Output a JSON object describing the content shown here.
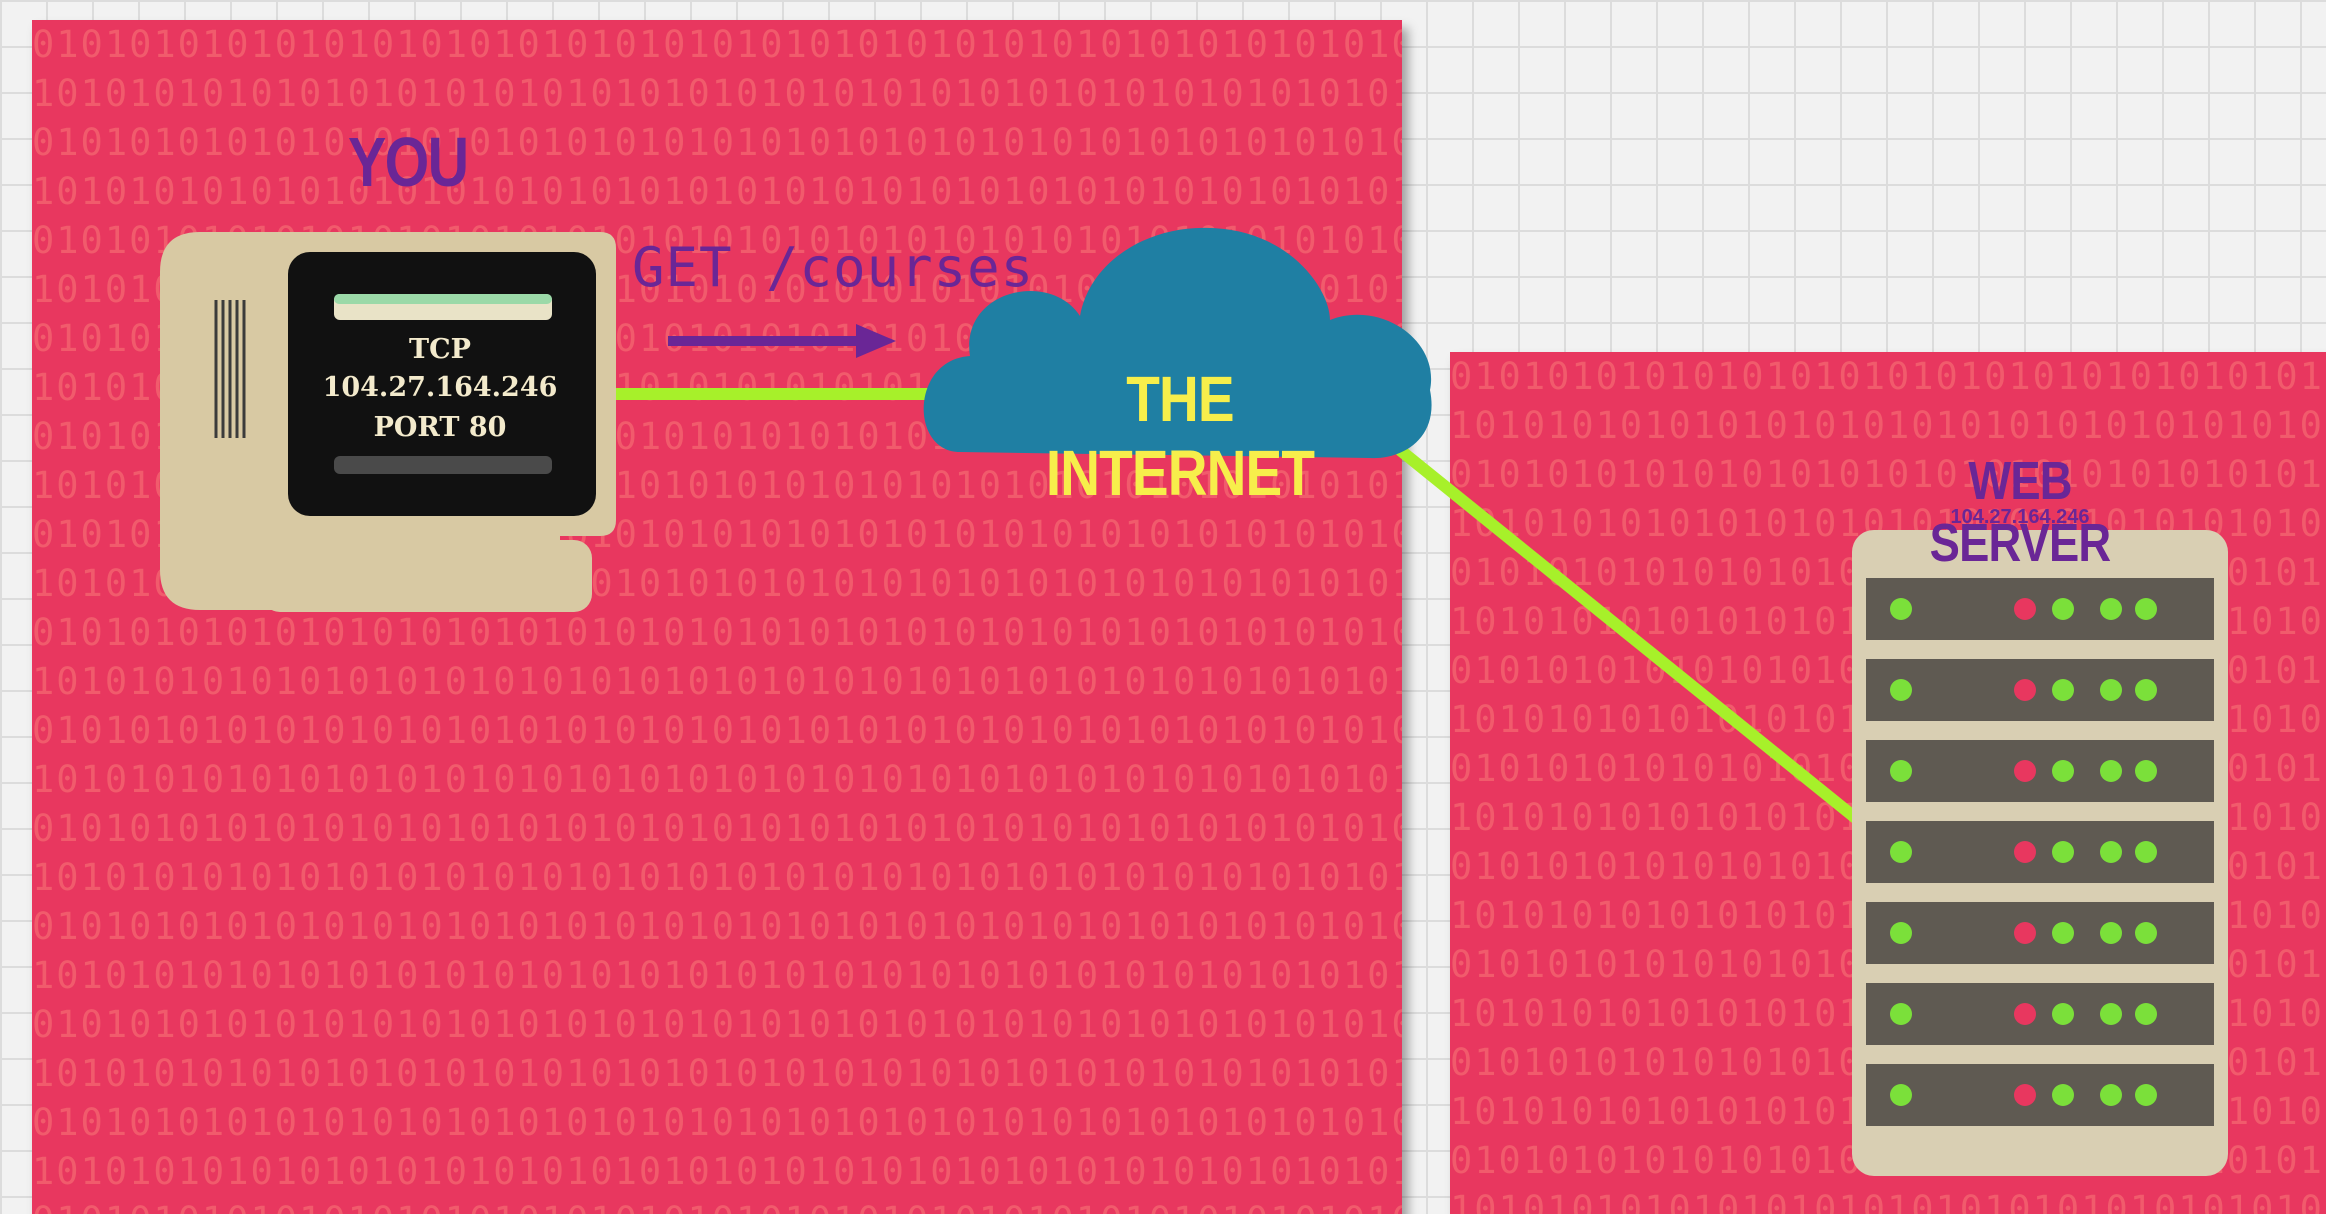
{
  "labels": {
    "you": "YOU",
    "request": "GET /courses",
    "internet": "THE INTERNET",
    "server": "WEB SERVER",
    "server_ip": "104.27.164.246"
  },
  "screen": {
    "protocol": "TCP",
    "ip": "104.27.164.246",
    "port": "PORT 80"
  },
  "binary_pattern": "0101010101010101010101010101010101010101010101010101010101010101",
  "server_rack": {
    "units": 7,
    "led_green": "#7be03a",
    "led_red": "#e8375f"
  },
  "colors": {
    "background_panel": "#e8375f",
    "connection_line": "#a7f02a",
    "cloud": "#1f7fa3",
    "cloud_text": "#f7ee4b",
    "label_purple": "#6a2696",
    "computer_beige": "#d8c9a3",
    "screen": "#111111",
    "server_body": "#d9cfb3",
    "server_unit": "#5f5a52"
  }
}
